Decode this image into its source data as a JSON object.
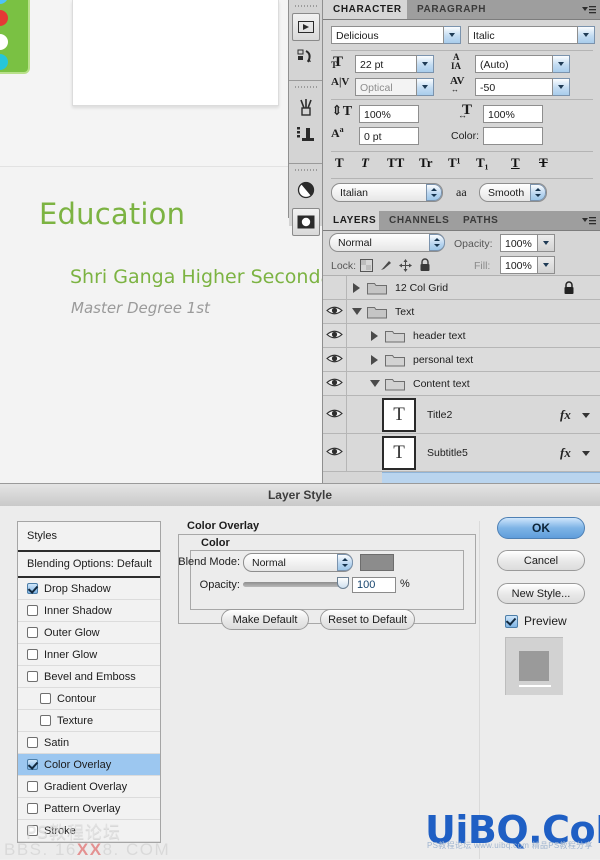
{
  "document": {
    "education_title": "Education",
    "school_name": "Shri Ganga Higher Secondary",
    "degree": "Master Degree 1st",
    "accent_green": "#7cb342",
    "muted_gray": "#9a9a9a"
  },
  "icon_dock": {
    "items": [
      {
        "name": "animation-icon",
        "glyph": "play"
      },
      {
        "name": "history-icon",
        "glyph": "history"
      },
      {
        "name": "brushes-icon",
        "glyph": "brush"
      },
      {
        "name": "clone-source-icon",
        "glyph": "stamp"
      },
      {
        "name": "adjustments-icon",
        "glyph": "half-circle"
      },
      {
        "name": "masks-icon",
        "glyph": "mask"
      }
    ]
  },
  "character_panel": {
    "tabs": [
      {
        "label": "CHARACTER",
        "active": true
      },
      {
        "label": "PARAGRAPH",
        "active": false
      }
    ],
    "font_family": "Delicious",
    "font_style": "Italic",
    "font_size_label": "font-size-icon",
    "font_size": "22 pt",
    "leading_label": "leading-icon",
    "leading": "(Auto)",
    "kerning_label": "kerning-icon",
    "kerning": "Optical",
    "tracking_label": "tracking-icon",
    "tracking": "-50",
    "vertical_scale": "100%",
    "horizontal_scale": "100%",
    "baseline_shift": "0 pt",
    "color_label": "Color:",
    "color_value": "#ffffff",
    "style_buttons": [
      "T",
      "T",
      "TT",
      "Tr",
      "T¹",
      "T₁",
      "T",
      "T"
    ],
    "language": "Italian",
    "antialias_label": "aa",
    "antialias": "Smooth"
  },
  "layers_panel": {
    "tabs": [
      {
        "label": "LAYERS",
        "active": true
      },
      {
        "label": "CHANNELS",
        "active": false
      },
      {
        "label": "PATHS",
        "active": false
      }
    ],
    "blend_mode": "Normal",
    "opacity_label": "Opacity:",
    "opacity_value": "100%",
    "lock_label": "Lock:",
    "fill_label": "Fill:",
    "fill_value": "100%",
    "rows": [
      {
        "name": "12 Col Grid",
        "type": "group",
        "visible": false,
        "expanded": false,
        "indent": 0,
        "locked": true,
        "fx": false
      },
      {
        "name": "Text",
        "type": "group",
        "visible": true,
        "expanded": true,
        "indent": 0,
        "locked": false,
        "fx": false
      },
      {
        "name": "header text",
        "type": "group",
        "visible": true,
        "expanded": false,
        "indent": 1,
        "locked": false,
        "fx": false
      },
      {
        "name": "personal text",
        "type": "group",
        "visible": true,
        "expanded": false,
        "indent": 1,
        "locked": false,
        "fx": false
      },
      {
        "name": "Content text",
        "type": "group",
        "visible": true,
        "expanded": true,
        "indent": 1,
        "locked": false,
        "fx": false
      },
      {
        "name": "Title2",
        "type": "text",
        "visible": true,
        "indent": 2,
        "locked": false,
        "fx": true,
        "thumb": "T"
      },
      {
        "name": "Subtitle5",
        "type": "text",
        "visible": true,
        "indent": 2,
        "locked": false,
        "fx": true,
        "thumb": "T"
      }
    ]
  },
  "layer_style": {
    "title": "Layer Style",
    "styles_header": "Styles",
    "blending_options": "Blending Options: Default",
    "effects": [
      {
        "label": "Drop Shadow",
        "checked": true,
        "indent": false,
        "selected": false
      },
      {
        "label": "Inner Shadow",
        "checked": false,
        "indent": false,
        "selected": false
      },
      {
        "label": "Outer Glow",
        "checked": false,
        "indent": false,
        "selected": false
      },
      {
        "label": "Inner Glow",
        "checked": false,
        "indent": false,
        "selected": false
      },
      {
        "label": "Bevel and Emboss",
        "checked": false,
        "indent": false,
        "selected": false
      },
      {
        "label": "Contour",
        "checked": false,
        "indent": true,
        "selected": false
      },
      {
        "label": "Texture",
        "checked": false,
        "indent": true,
        "selected": false
      },
      {
        "label": "Satin",
        "checked": false,
        "indent": false,
        "selected": false
      },
      {
        "label": "Color Overlay",
        "checked": true,
        "indent": false,
        "selected": true
      },
      {
        "label": "Gradient Overlay",
        "checked": false,
        "indent": false,
        "selected": false
      },
      {
        "label": "Pattern Overlay",
        "checked": false,
        "indent": false,
        "selected": false
      },
      {
        "label": "Stroke",
        "checked": false,
        "indent": false,
        "selected": false
      }
    ],
    "section_title": "Color Overlay",
    "color_group_title": "Color",
    "blend_mode_label": "Blend Mode:",
    "blend_mode_value": "Normal",
    "overlay_color": "#8c8c8c",
    "opacity_label": "Opacity:",
    "opacity_value": "100",
    "opacity_unit": "%",
    "make_default": "Make Default",
    "reset_default": "Reset to Default",
    "ok": "OK",
    "cancel": "Cancel",
    "new_style": "New Style...",
    "preview_label": "Preview",
    "preview_checked": true
  },
  "watermarks": {
    "left_cn": "PS教程论坛",
    "left_bbs_a": "BBS. 16",
    "left_bbs_red": "XX",
    "left_bbs_b": "8. COM",
    "right_main_a": "U",
    "right_main_b": "iBQ.CoM",
    "right_sub": "PS教程论坛 www.uibq.com 精品PS教程分享"
  }
}
